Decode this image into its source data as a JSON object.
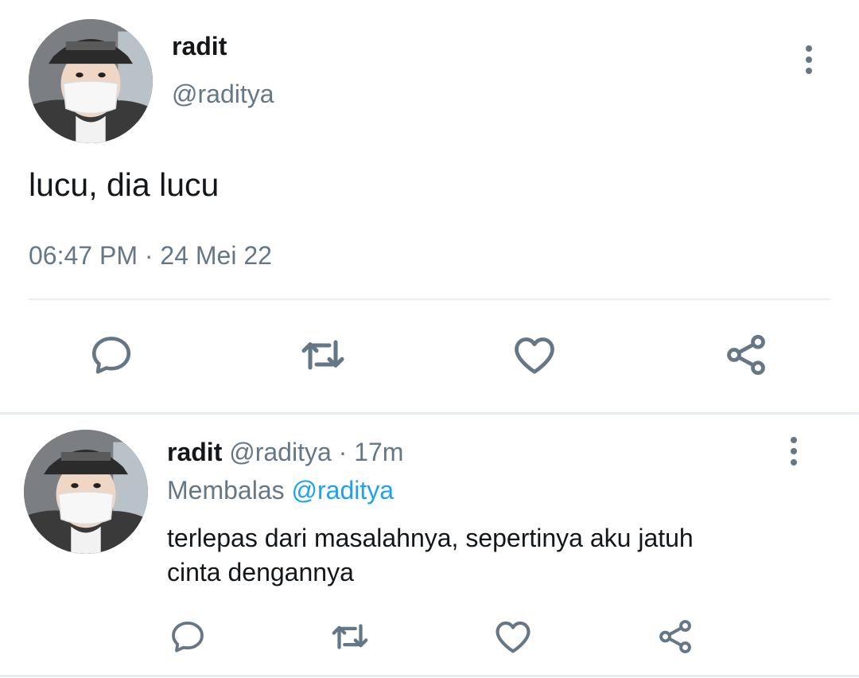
{
  "main_tweet": {
    "author_name": "radit",
    "author_handle": "@raditya",
    "text": "lucu, dia lucu",
    "timestamp": "06:47 PM · 24 Mei 22",
    "avatar_icon": "user-avatar-photo",
    "actions": [
      "reply-icon",
      "retweet-icon",
      "like-icon",
      "share-icon"
    ]
  },
  "reply_tweet": {
    "author_name": "radit",
    "author_handle": "@raditya",
    "time_sep": "·",
    "relative_time": "17m",
    "replying_prefix": "Membalas",
    "replying_to": "@raditya",
    "text_line1": "terlepas dari masalahnya, sepertinya aku jatuh",
    "text_line2": "cinta dengannya",
    "avatar_icon": "user-avatar-photo",
    "actions": [
      "reply-icon",
      "retweet-icon",
      "like-icon",
      "share-icon"
    ]
  },
  "colors": {
    "text": "#14171a",
    "secondary": "#657786",
    "accent": "#1da1f2",
    "divider": "#e6ecf0"
  }
}
